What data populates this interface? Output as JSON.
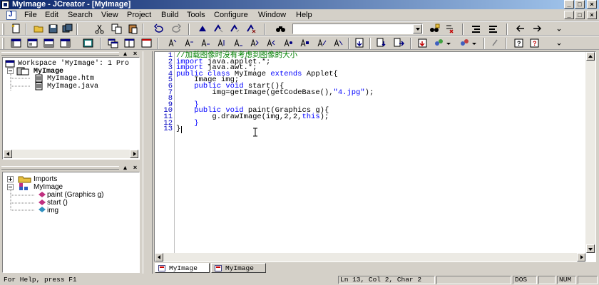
{
  "window": {
    "title": "MyImage - JCreator - [MyImage]"
  },
  "menu": {
    "items": [
      {
        "label": "File"
      },
      {
        "label": "Edit"
      },
      {
        "label": "Search"
      },
      {
        "label": "View"
      },
      {
        "label": "Project"
      },
      {
        "label": "Build"
      },
      {
        "label": "Tools"
      },
      {
        "label": "Configure"
      },
      {
        "label": "Window"
      },
      {
        "label": "Help"
      }
    ]
  },
  "workspace": {
    "title": "Workspace 'MyImage': 1 Pro",
    "project": "MyImage",
    "files": [
      "MyImage.htm",
      "MyImage.java"
    ]
  },
  "classview": {
    "imports": "Imports",
    "class": "MyImage",
    "members": [
      "paint (Graphics g)",
      "start ()",
      "img"
    ]
  },
  "editor": {
    "line_numbers": [
      "1",
      "2",
      "3",
      "4",
      "5",
      "6",
      "7",
      "8",
      "9",
      "10",
      "11",
      "12",
      "13"
    ],
    "lines": {
      "l1": "//加载图像时没有考虑到图像的大小",
      "l2_kw": "import",
      "l2_rest": " java.applet.*;",
      "l3_kw": "import",
      "l3_rest": " java.awt.*;",
      "l4_kw1": "public class",
      "l4_mid": " MyImage ",
      "l4_kw2": "extends",
      "l4_rest": " Applet{",
      "l5": "    Image img;",
      "l6_indent": "    ",
      "l6_kw": "public void",
      "l6_rest": " start(){",
      "l7_pre": "        img=getImage(getCodeBase(),",
      "l7_str": "\"4.jpg\"",
      "l7_post": ");",
      "l8": "",
      "l9": "    }",
      "l10_indent": "    ",
      "l10_kw": "public void",
      "l10_rest": " paint(Graphics g){",
      "l11_pre": "        g.drawImage(img,2,2,",
      "l11_kw": "this",
      "l11_post": ");",
      "l12": "    }",
      "l13": "}"
    }
  },
  "tabs": [
    "MyImage",
    "MyImage"
  ],
  "status": {
    "help": "For Help, press F1",
    "position": "Ln 13, Col 2, Char 2",
    "mode": "DOS",
    "num": "NUM"
  },
  "colors": {
    "keyword": "#0000ff",
    "comment": "#008000",
    "line_number": "#0000c0",
    "title_gradient_start": "#0a246a"
  }
}
